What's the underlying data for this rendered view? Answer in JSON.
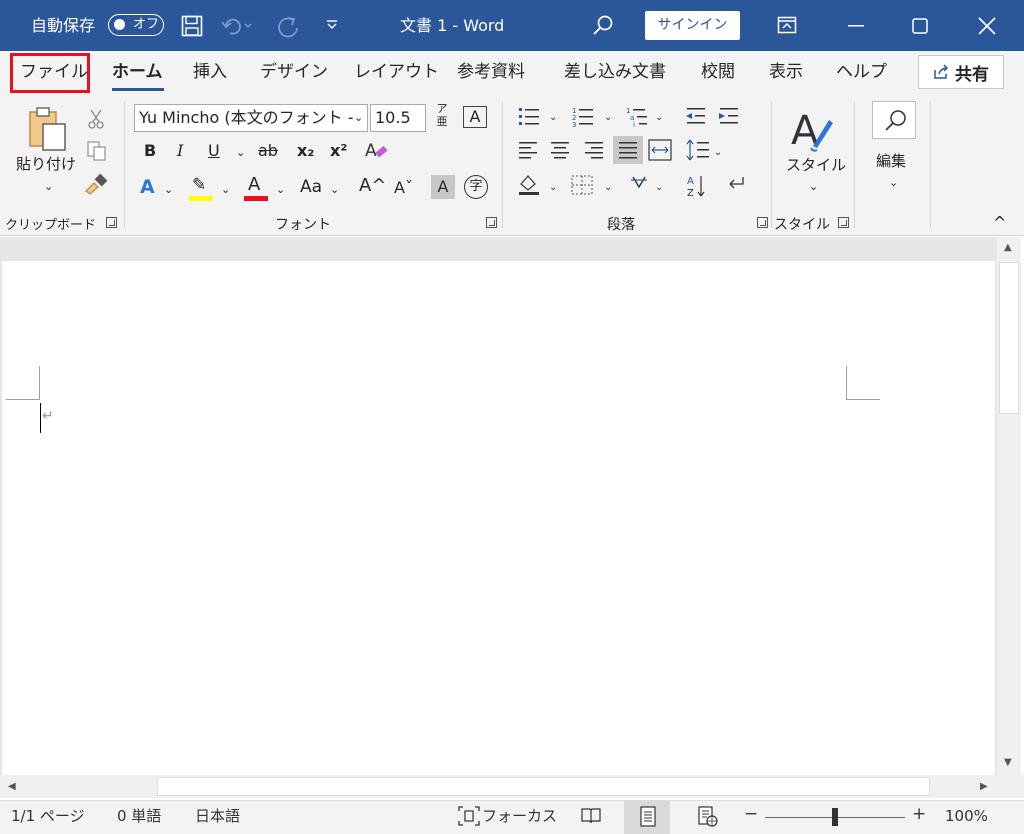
{
  "title_bar": {
    "autosave_label": "自動保存",
    "autosave_state": "オフ",
    "document_title": "文書 1  -  Word",
    "signin_label": "サインイン"
  },
  "tabs": {
    "file": "ファイル",
    "home": "ホーム",
    "insert": "挿入",
    "design": "デザイン",
    "layout": "レイアウト",
    "references": "参考資料",
    "mailings": "差し込み文書",
    "review": "校閲",
    "view": "表示",
    "help": "ヘルプ",
    "share": "共有"
  },
  "ribbon": {
    "clipboard": {
      "paste_label": "貼り付け",
      "group_label": "クリップボード"
    },
    "font": {
      "font_name": "Yu Mincho (本文のフォント -",
      "font_size": "10.5",
      "phonetic_top": "ア",
      "phonetic_bottom": "亜",
      "boxed_char": "A",
      "bold": "B",
      "italic": "I",
      "underline": "U",
      "strike": "ab",
      "subscript": "x₂",
      "superscript": "x²",
      "effects": "A",
      "highlight": "✎",
      "font_color": "A",
      "change_case": "Aa",
      "grow": "A^",
      "shrink": "Aˇ",
      "shading": "A",
      "enclose": "字",
      "group_label": "フォント"
    },
    "paragraph": {
      "group_label": "段落"
    },
    "styles": {
      "styles_label": "スタイル",
      "group_label": "スタイル"
    },
    "editing": {
      "label": "編集"
    }
  },
  "status": {
    "page": "1/1 ページ",
    "words": "0 単語",
    "language": "日本語",
    "focus": "フォーカス",
    "zoom_minus": "−",
    "zoom_plus": "+",
    "zoom": "100%"
  },
  "colors": {
    "title_bar": "#2b579a",
    "highlight_yellow": "#ffff00",
    "font_red": "#e81123",
    "accent_blue": "#2b579a"
  }
}
